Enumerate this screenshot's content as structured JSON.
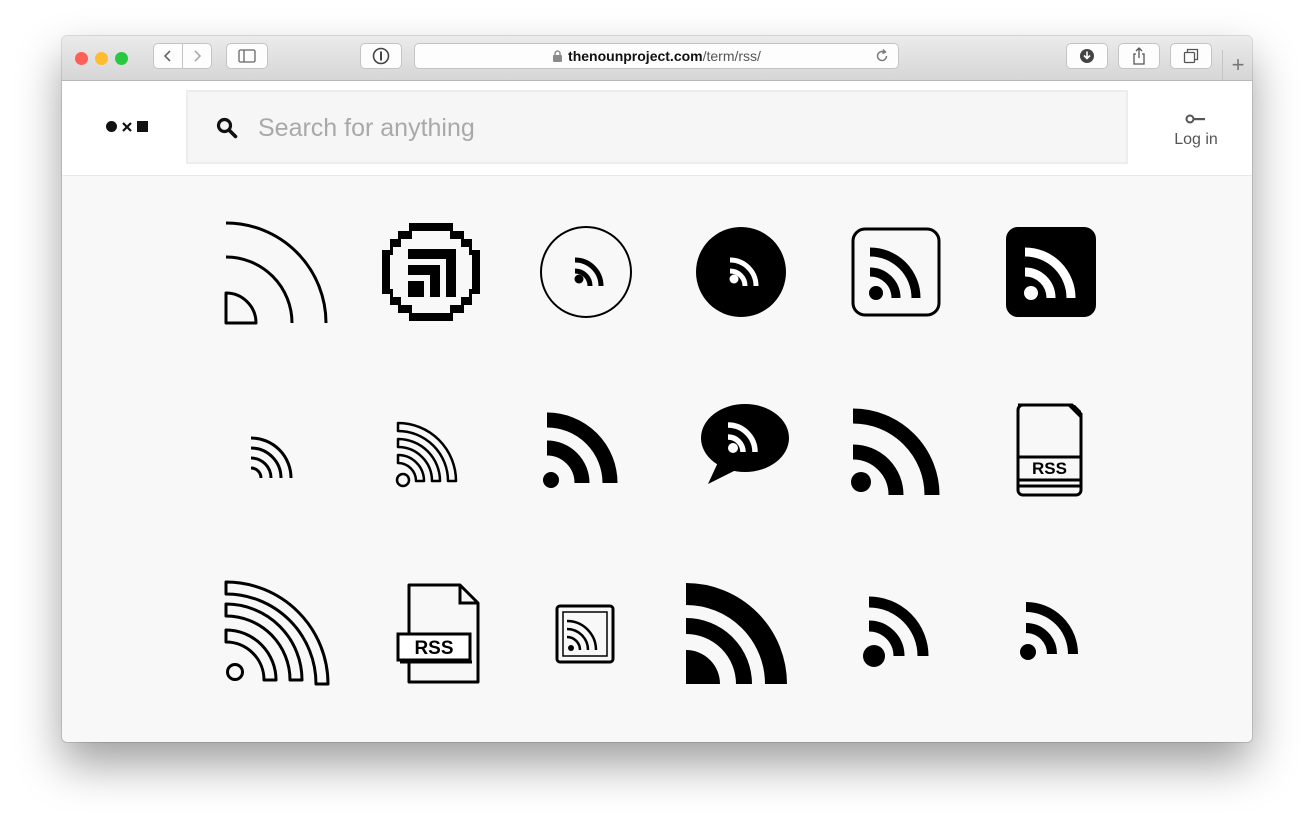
{
  "browser": {
    "url_host": "thenounproject.com",
    "url_path": "/term/rss/",
    "new_tab_label": "+",
    "traffic_colors": {
      "close": "#ff5f57",
      "minimize": "#febc2e",
      "zoom": "#28c840"
    }
  },
  "site": {
    "search_placeholder": "Search for anything",
    "login_label": "Log in"
  },
  "results": [
    {
      "icon": "rss-quarter-outline-icon"
    },
    {
      "icon": "rss-pixel-circle-icon"
    },
    {
      "icon": "rss-circle-outline-icon"
    },
    {
      "icon": "rss-circle-filled-icon"
    },
    {
      "icon": "rss-rounded-square-outline-icon"
    },
    {
      "icon": "rss-rounded-square-filled-icon"
    },
    {
      "icon": "rss-thin-waves-icon"
    },
    {
      "icon": "rss-outline-waves-icon"
    },
    {
      "icon": "rss-bold-waves-icon"
    },
    {
      "icon": "rss-speech-bubble-icon"
    },
    {
      "icon": "rss-large-bold-icon"
    },
    {
      "icon": "rss-file-icon",
      "label": "RSS"
    },
    {
      "icon": "rss-outline-feed-icon"
    },
    {
      "icon": "rss-document-icon",
      "label": "RSS"
    },
    {
      "icon": "rss-small-square-icon"
    },
    {
      "icon": "rss-heavy-arcs-icon"
    },
    {
      "icon": "rss-compact-bold-icon"
    },
    {
      "icon": "rss-small-bold-icon"
    }
  ]
}
